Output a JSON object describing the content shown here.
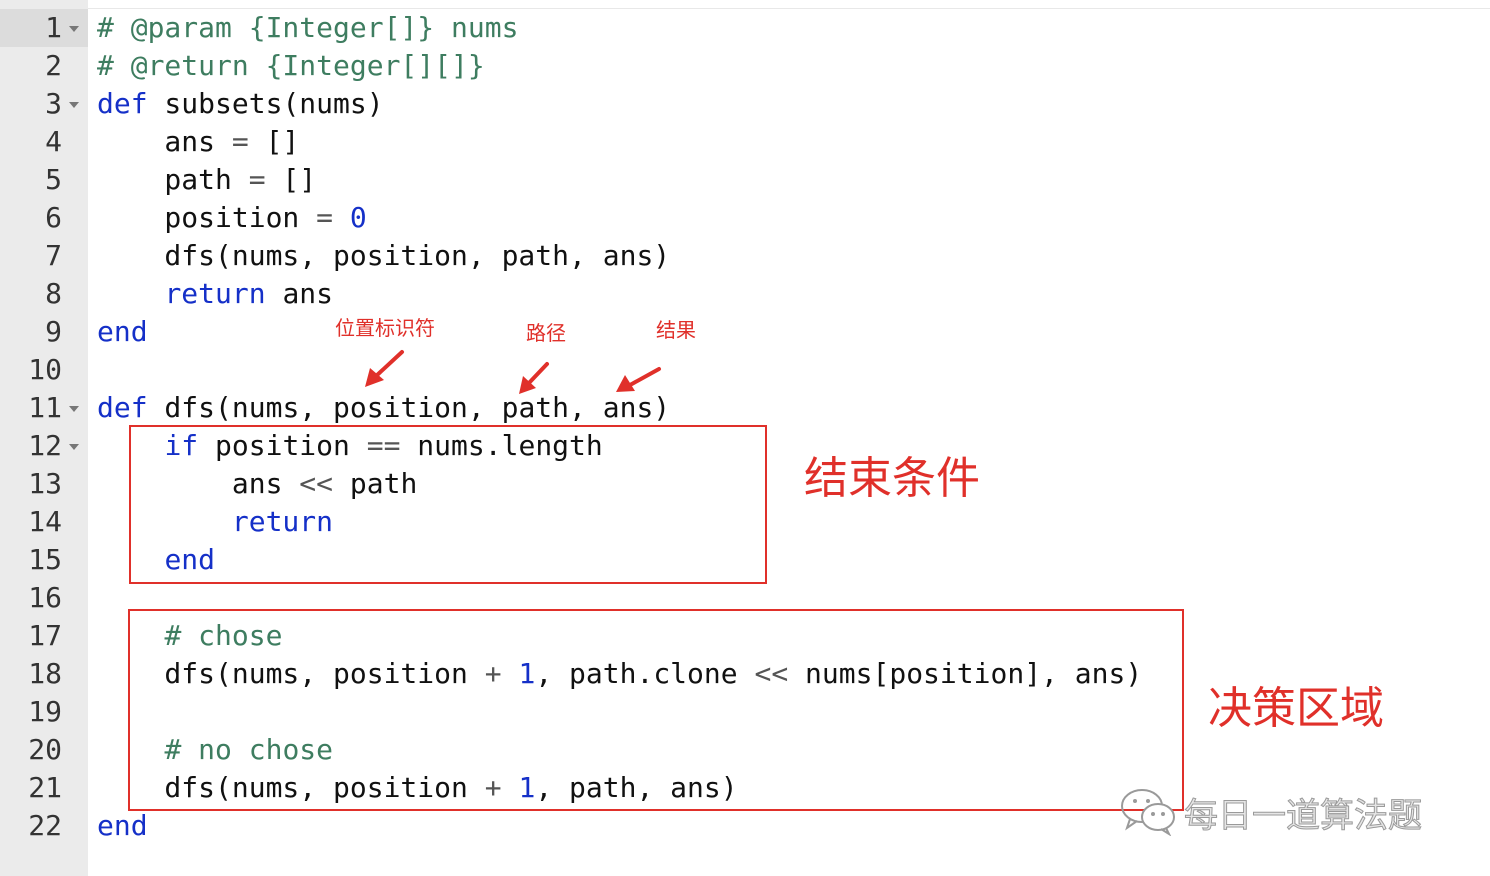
{
  "editor": {
    "line_numbers": [
      "1",
      "2",
      "3",
      "4",
      "5",
      "6",
      "7",
      "8",
      "9",
      "10",
      "11",
      "12",
      "13",
      "14",
      "15",
      "16",
      "17",
      "18",
      "19",
      "20",
      "21",
      "22"
    ],
    "folded_lines": [
      1,
      3,
      11,
      12
    ],
    "lines": [
      [
        {
          "t": "cmt",
          "v": "# @param {Integer[]} nums"
        }
      ],
      [
        {
          "t": "cmt",
          "v": "# @return {Integer[][]}"
        }
      ],
      [
        {
          "t": "kw",
          "v": "def"
        },
        {
          "t": "id",
          "v": " subsets(nums)"
        }
      ],
      [
        {
          "t": "id",
          "v": "    ans "
        },
        {
          "t": "op",
          "v": "="
        },
        {
          "t": "id",
          "v": " []"
        }
      ],
      [
        {
          "t": "id",
          "v": "    path "
        },
        {
          "t": "op",
          "v": "="
        },
        {
          "t": "id",
          "v": " []"
        }
      ],
      [
        {
          "t": "id",
          "v": "    position "
        },
        {
          "t": "op",
          "v": "="
        },
        {
          "t": "id",
          "v": " "
        },
        {
          "t": "num",
          "v": "0"
        }
      ],
      [
        {
          "t": "id",
          "v": "    dfs(nums, position, path, ans)"
        }
      ],
      [
        {
          "t": "id",
          "v": "    "
        },
        {
          "t": "kw",
          "v": "return"
        },
        {
          "t": "id",
          "v": " ans"
        }
      ],
      [
        {
          "t": "kw",
          "v": "end"
        }
      ],
      [],
      [
        {
          "t": "kw",
          "v": "def"
        },
        {
          "t": "id",
          "v": " dfs(nums, position, path, ans)"
        }
      ],
      [
        {
          "t": "id",
          "v": "    "
        },
        {
          "t": "kw",
          "v": "if"
        },
        {
          "t": "id",
          "v": " position "
        },
        {
          "t": "op",
          "v": "=="
        },
        {
          "t": "id",
          "v": " nums.length"
        }
      ],
      [
        {
          "t": "id",
          "v": "        ans "
        },
        {
          "t": "op",
          "v": "<<"
        },
        {
          "t": "id",
          "v": " path"
        }
      ],
      [
        {
          "t": "id",
          "v": "        "
        },
        {
          "t": "kw",
          "v": "return"
        }
      ],
      [
        {
          "t": "id",
          "v": "    "
        },
        {
          "t": "kw",
          "v": "end"
        }
      ],
      [],
      [
        {
          "t": "id",
          "v": "    "
        },
        {
          "t": "cmt",
          "v": "# chose"
        }
      ],
      [
        {
          "t": "id",
          "v": "    dfs(nums, position "
        },
        {
          "t": "op",
          "v": "+"
        },
        {
          "t": "id",
          "v": " "
        },
        {
          "t": "num",
          "v": "1"
        },
        {
          "t": "id",
          "v": ", path.clone "
        },
        {
          "t": "op",
          "v": "<<"
        },
        {
          "t": "id",
          "v": " nums[position], ans)"
        }
      ],
      [],
      [
        {
          "t": "id",
          "v": "    "
        },
        {
          "t": "cmt",
          "v": "# no chose"
        }
      ],
      [
        {
          "t": "id",
          "v": "    dfs(nums, position "
        },
        {
          "t": "op",
          "v": "+"
        },
        {
          "t": "id",
          "v": " "
        },
        {
          "t": "num",
          "v": "1"
        },
        {
          "t": "id",
          "v": ", path, ans)"
        }
      ],
      [
        {
          "t": "kw",
          "v": "end"
        }
      ]
    ]
  },
  "annotations": {
    "position_label": "位置标识符",
    "path_label": "路径",
    "ans_label": "结果",
    "end_condition": "结束条件",
    "decision_area": "决策区域"
  },
  "watermark": {
    "text": "每日一道算法题",
    "icon": "wechat-icon"
  },
  "colors": {
    "annotation_red": "#e0302a",
    "keyword_blue": "#1530c8",
    "comment_green": "#3e7d60",
    "gutter_bg": "#ebebeb"
  }
}
